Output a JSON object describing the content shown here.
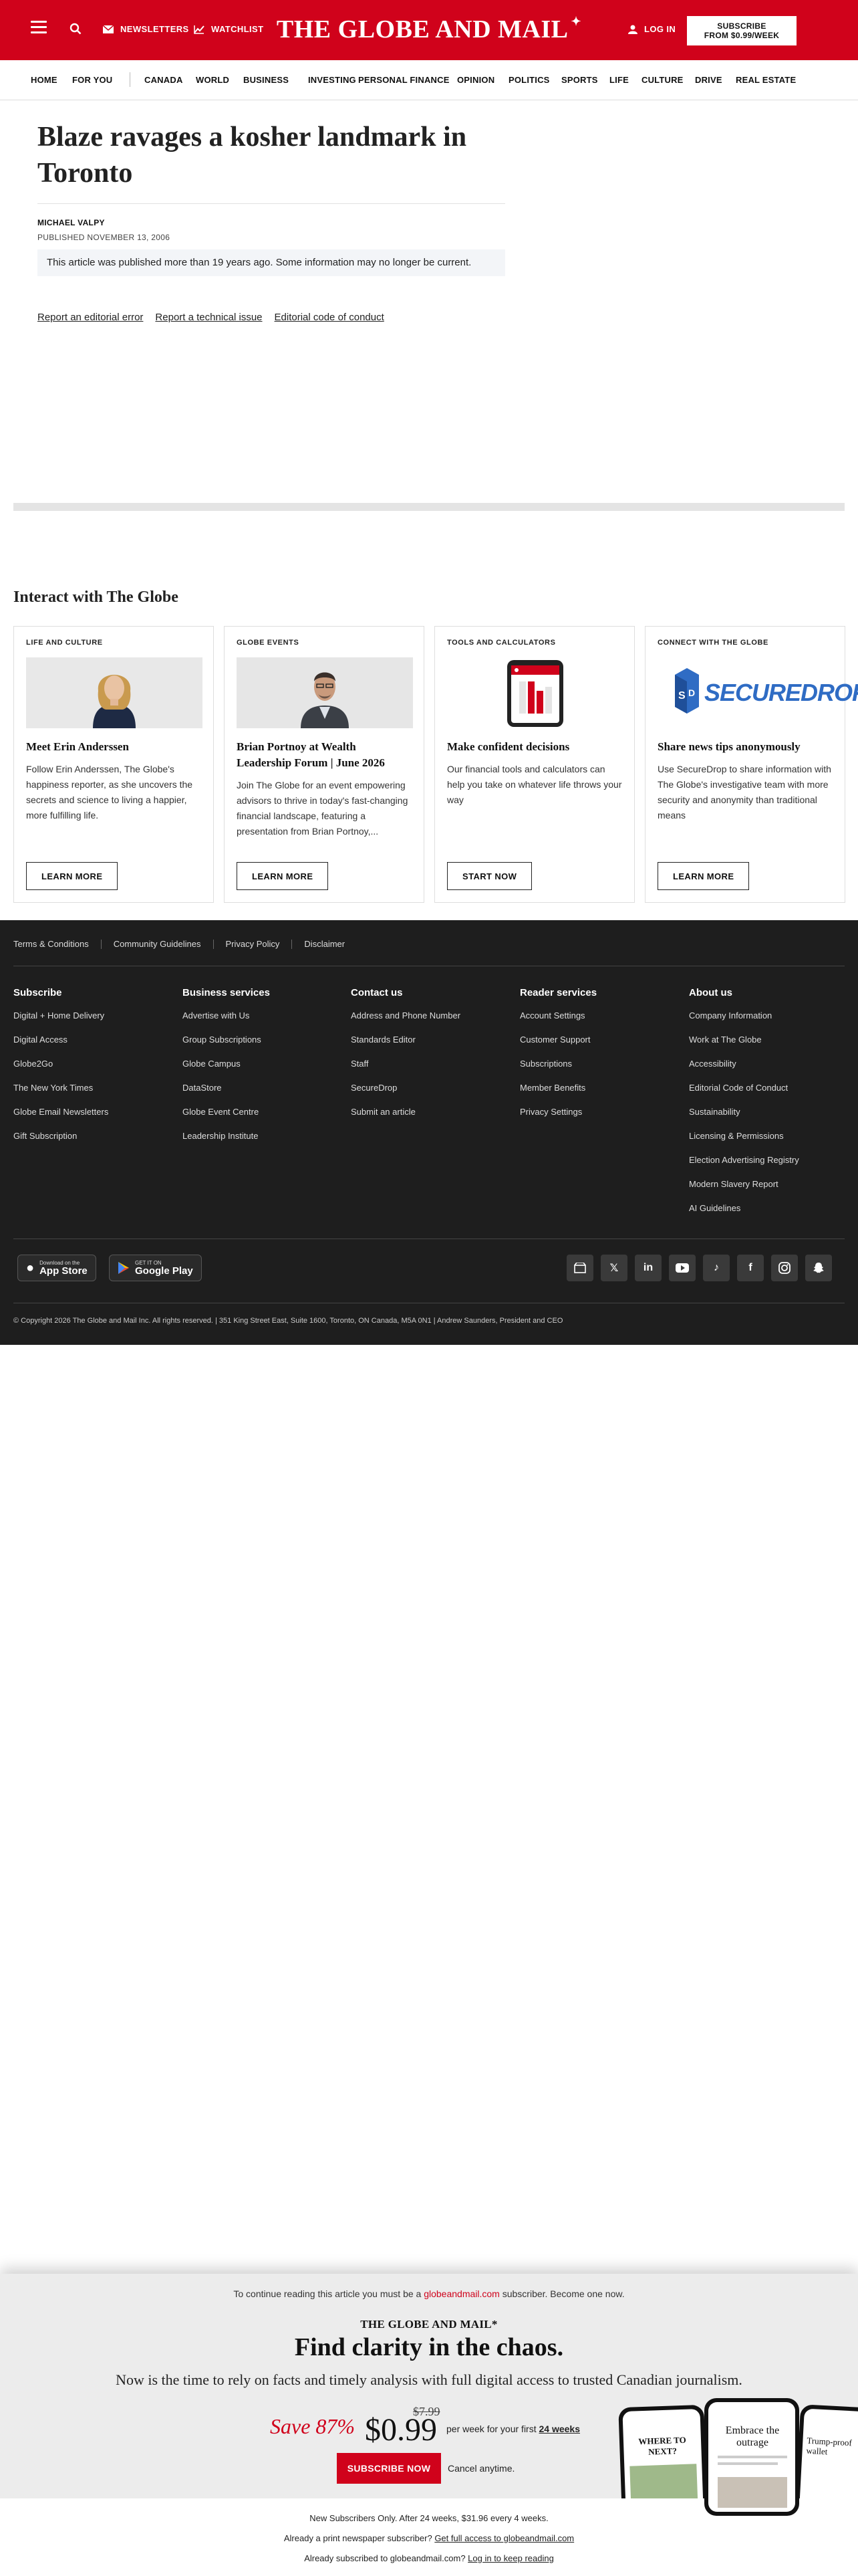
{
  "header": {
    "newsletters": "NEWSLETTERS",
    "watchlist": "WATCHLIST",
    "logo": "THE GLOBE AND MAIL",
    "login": "LOG IN",
    "subscribe_line1": "SUBSCRIBE",
    "subscribe_line2": "FROM $0.99/WEEK",
    "brand_color": "#d0021b"
  },
  "nav": {
    "items": [
      "HOME",
      "FOR YOU",
      "CANADA",
      "WORLD",
      "BUSINESS",
      "INVESTING",
      "PERSONAL FINANCE",
      "OPINION",
      "POLITICS",
      "SPORTS",
      "LIFE",
      "CULTURE",
      "DRIVE",
      "REAL ESTATE"
    ]
  },
  "article": {
    "headline": "Blaze ravages a kosher landmark in Toronto",
    "author": "MICHAEL VALPY",
    "published": "PUBLISHED NOVEMBER 13, 2006",
    "notice": "This article was published more than 19 years ago. Some information may no longer be current.",
    "links": [
      "Report an editorial error",
      "Report a technical issue",
      "Editorial code of conduct"
    ]
  },
  "interact": {
    "title": "Interact with The Globe",
    "cards": [
      {
        "kicker": "LIFE AND CULTURE",
        "title": "Meet Erin Anderssen",
        "desc": "Follow Erin Anderssen, The Globe's happiness reporter, as she uncovers the secrets and science to living a happier, more fulfilling life.",
        "button": "LEARN MORE"
      },
      {
        "kicker": "GLOBE EVENTS",
        "title": "Brian Portnoy at Wealth Leadership Forum | June 2026",
        "desc": "Join The Globe for an event empowering advisors to thrive in today's fast-changing financial landscape, featuring a presentation from Brian Portnoy,...",
        "button": "LEARN MORE"
      },
      {
        "kicker": "TOOLS AND CALCULATORS",
        "title": "Make confident decisions",
        "desc": "Our financial tools and calculators can help you take on whatever life throws your way",
        "button": "START NOW"
      },
      {
        "kicker": "CONNECT WITH THE GLOBE",
        "title": "Share news tips anonymously",
        "desc": "Use SecureDrop to share information with The Globe's investigative team with more security and anonymity than traditional means",
        "button": "LEARN MORE",
        "logo_text": "SECUREDROP"
      }
    ]
  },
  "footer": {
    "top_links": [
      "Terms & Conditions",
      "Community Guidelines",
      "Privacy Policy",
      "Disclaimer"
    ],
    "columns": [
      {
        "heading": "Subscribe",
        "items": [
          "Digital + Home Delivery",
          "Digital Access",
          "Globe2Go",
          "The New York Times",
          "Globe Email Newsletters",
          "Gift Subscription"
        ]
      },
      {
        "heading": "Business services",
        "items": [
          "Advertise with Us",
          "Group Subscriptions",
          "Globe Campus",
          "DataStore",
          "Globe Event Centre",
          "Leadership Institute"
        ]
      },
      {
        "heading": "Contact us",
        "items": [
          "Address and Phone Number",
          "Standards Editor",
          "Staff",
          "SecureDrop",
          "Submit an article"
        ]
      },
      {
        "heading": "Reader services",
        "items": [
          "Account Settings",
          "Customer Support",
          "Subscriptions",
          "Member Benefits",
          "Privacy Settings"
        ]
      },
      {
        "heading": "About us",
        "items": [
          "Company Information",
          "Work at The Globe",
          "Accessibility",
          "Editorial Code of Conduct",
          "Sustainability",
          "Licensing & Permissions",
          "Election Advertising Registry",
          "Modern Slavery Report",
          "AI Guidelines"
        ]
      }
    ],
    "app_store": {
      "small": "Download on the",
      "big": "App Store"
    },
    "google_play": {
      "small": "GET IT ON",
      "big": "Google Play"
    },
    "copyright": "© Copyright 2026 The Globe and Mail Inc. All rights reserved.  |  351 King Street East, Suite 1600, Toronto, ON Canada, M5A 0N1  |  Andrew Saunders, President and CEO"
  },
  "paywall": {
    "intro_before": "To continue reading this article you must be a ",
    "intro_link": "globeandmail.com",
    "intro_after": " subscriber. Become one now.",
    "logo": "THE GLOBE AND MAIL*",
    "headline": "Find clarity in the chaos.",
    "subhead": "Now is the time to rely on facts and timely analysis with full digital access to trusted Canadian journalism.",
    "save": "Save 87%",
    "old_price": "$7.99",
    "price": "$0.99",
    "per_week": "per week for your first ",
    "weeks": "24 weeks",
    "button": "SUBSCRIBE NOW",
    "cancel": "Cancel anytime.",
    "fine1": "New Subscribers Only. After 24 weeks, $31.96 every 4 weeks.",
    "fine2_before": "Already a print newspaper subscriber? ",
    "fine2_link": "Get full access to globeandmail.com",
    "fine3_before": "Already subscribed to globeandmail.com? ",
    "fine3_link": "Log in to keep reading",
    "phone_texts": [
      "WHERE TO NEXT?",
      "Embrace the outrage",
      "Trump-proof wallet"
    ]
  }
}
